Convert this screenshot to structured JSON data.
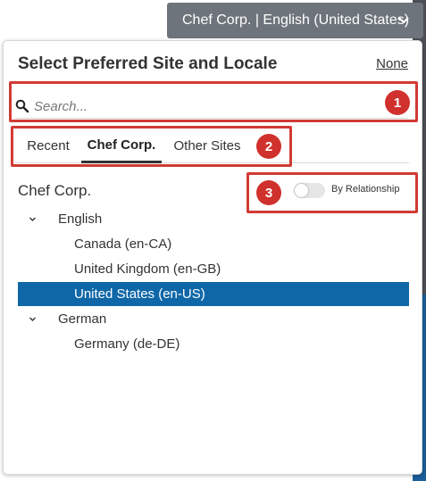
{
  "header": {
    "site_locale_label": "Chef Corp. | English (United States)",
    "chevron_icon": "chevron-down-icon"
  },
  "panel": {
    "title": "Select Preferred Site and Locale",
    "none_label": "None"
  },
  "search": {
    "placeholder": "Search...",
    "value": "",
    "icon": "search-icon"
  },
  "tabs": [
    {
      "label": "Recent",
      "active": false
    },
    {
      "label": "Chef Corp.",
      "active": true
    },
    {
      "label": "Other Sites",
      "active": false
    }
  ],
  "site": {
    "name": "Chef Corp.",
    "toggle_label": "By Relationship",
    "toggle_on": false
  },
  "tree": [
    {
      "label": "English",
      "expanded": true
    },
    {
      "label": "Canada (en-CA)",
      "selected": false
    },
    {
      "label": "United Kingdom (en-GB)",
      "selected": false
    },
    {
      "label": "United States (en-US)",
      "selected": true
    },
    {
      "label": "German",
      "expanded": true
    },
    {
      "label": "Germany (de-DE)",
      "selected": false
    }
  ],
  "annotations": [
    "1",
    "2",
    "3"
  ],
  "colors": {
    "selected_row": "#0f67a8",
    "annotation": "#d23a34",
    "top_selector": "#6e747b"
  }
}
